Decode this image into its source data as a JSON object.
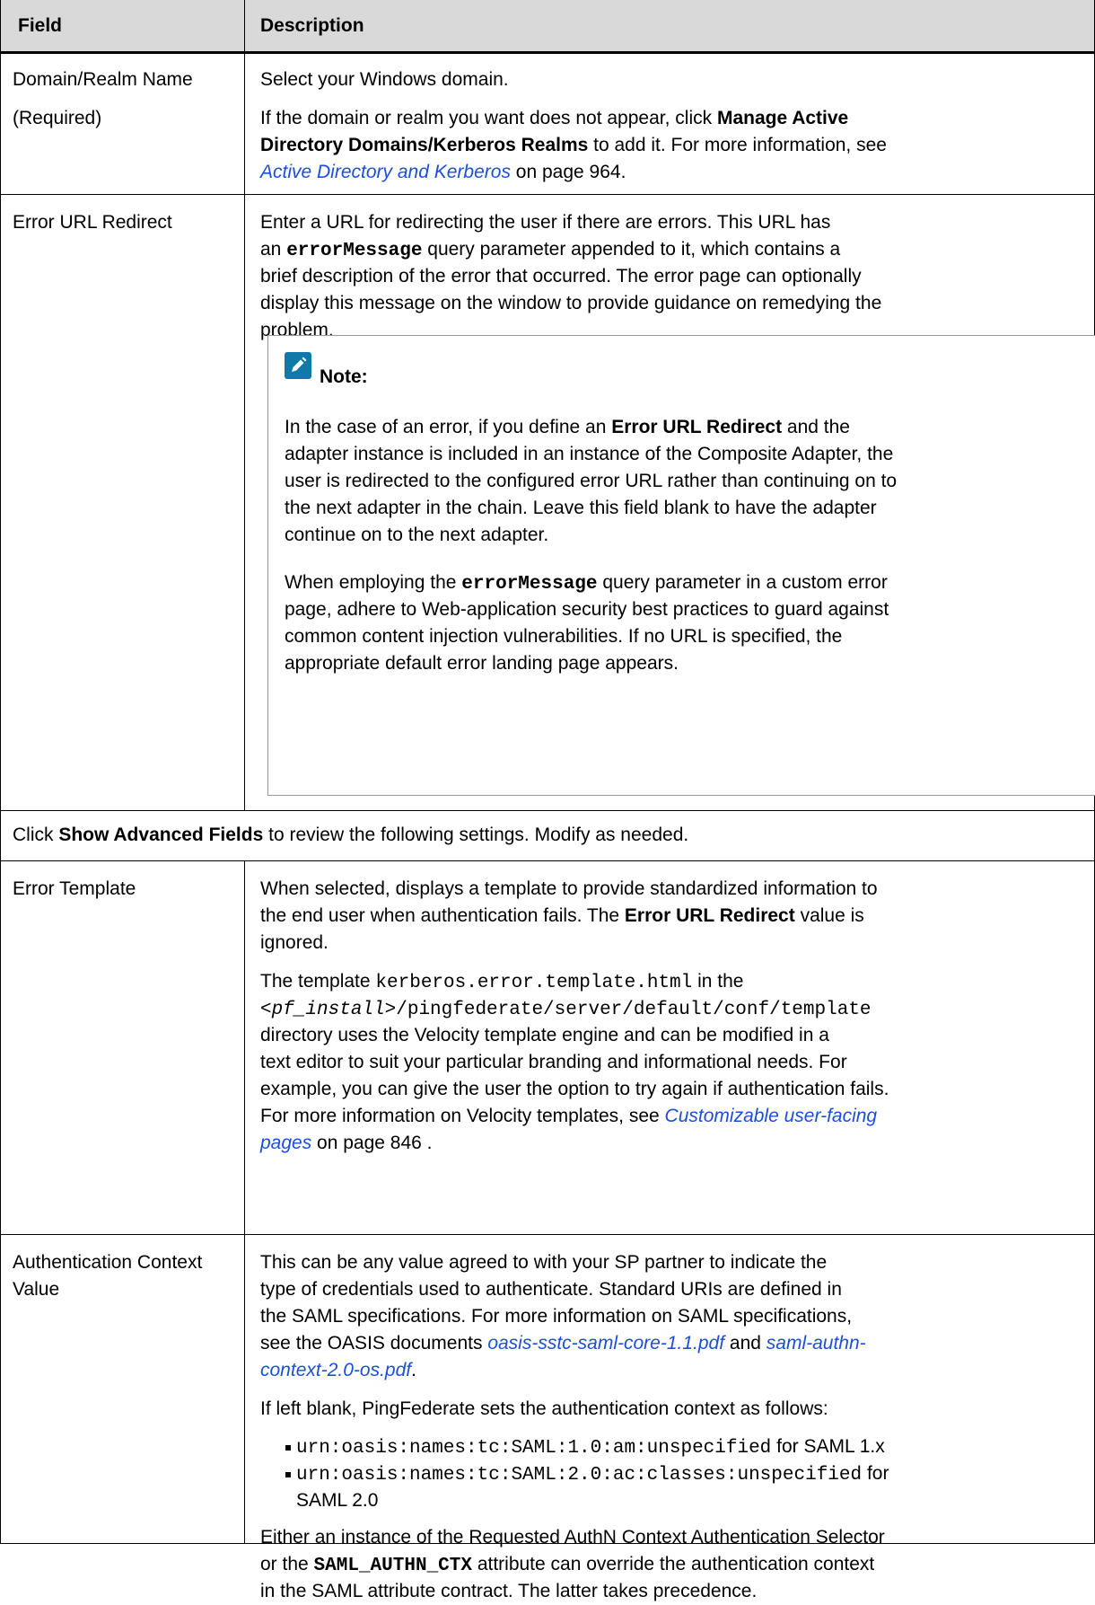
{
  "header": {
    "field": "Field",
    "description": "Description"
  },
  "row1": {
    "field1": "Domain/Realm Name",
    "field2": "(Required)",
    "desc1": "Select your Windows domain.",
    "p2_l1a": "If the domain or realm you want does not appear, click ",
    "p2_l1b": "Manage Active",
    "p2_l2a": "Directory Domains/Kerberos Realms",
    "p2_l2b": " to add it. For more information, see",
    "p2_l3_link": "Active Directory and Kerberos",
    "p2_l3b": " on page 964."
  },
  "row2": {
    "field": "Error URL Redirect",
    "l1": "Enter a URL for redirecting the user if there are errors. This URL has",
    "l2a": "an ",
    "l2_code": "errorMessage",
    "l2b": " query parameter appended to it, which contains a",
    "l3": "brief description of the error that occurred. The error page can optionally",
    "l4": "display this message on the window to provide guidance on remedying the",
    "l5": "problem.",
    "note_title": "Note:",
    "n1a": "In the case of an error, if you define an ",
    "n1b": "Error URL Redirect",
    "n1c": " and the",
    "n2": "adapter instance is included in an instance of the Composite Adapter, the",
    "n3": "user is redirected to the configured error URL rather than continuing on to",
    "n4": "the next adapter in the chain. Leave this field blank to have the adapter",
    "n5": "continue on to the next adapter.",
    "m1a": "When employing the ",
    "m1_code": "errorMessage",
    "m1b": " query parameter in a custom error",
    "m2": "page, adhere to Web-application security best practices to guard against",
    "m3": "common content injection vulnerabilities. If no URL is specified, the",
    "m4": "appropriate default error landing page appears."
  },
  "advanced": {
    "a": "Click ",
    "b": "Show Advanced Fields",
    "c": " to review the following settings. Modify as needed."
  },
  "row3": {
    "field": "Error Template",
    "l1": "When selected, displays a template to provide standardized information to",
    "l2a": "the end user when authentication fails. The ",
    "l2b": "Error URL Redirect",
    "l2c": " value is",
    "l3": "ignored.",
    "p2_l1a": "The template ",
    "p2_l1_code": "kerberos.error.template.html",
    "p2_l1b": " in the",
    "p2_l2_it": "<pf_install>",
    "p2_l2_code": "/pingfederate/server/default/conf/template",
    "p2_l3": "directory uses the Velocity template engine and can be modified in a",
    "p2_l4": "text editor to suit your particular branding and informational needs. For",
    "p2_l5": "example, you can give the user the option to try again if authentication fails.",
    "p2_l6a": "For more information on Velocity templates, see ",
    "p2_l6_link": "Customizable user-facing",
    "p2_l7_link": "pages",
    "p2_l7b": " on page 846 ."
  },
  "row4": {
    "field1": "Authentication Context",
    "field2": "Value",
    "l1": "This can be any value agreed to with your SP partner to indicate the",
    "l2": "type of credentials used to authenticate. Standard URIs are defined in",
    "l3": "the SAML specifications. For more information on SAML specifications,",
    "l4a": "see the OASIS documents ",
    "l4_link1": "oasis-sstc-saml-core-1.1.pdf",
    "l4b": " and ",
    "l4_link2": "saml-authn-",
    "l5_link": "context-2.0-os.pdf",
    "l5b": ".",
    "blank": "If left blank, PingFederate sets the authentication context as follows:",
    "b1_code": "urn:oasis:names:tc:SAML:1.0:am:unspecified",
    "b1_txt": " for SAML 1.x",
    "b2_code": "urn:oasis:names:tc:SAML:2.0:ac:classes:unspecified",
    "b2_txt": " for",
    "b2_l2": "SAML 2.0",
    "e1": "Either an instance of the Requested AuthN Context Authentication Selector",
    "e2a": "or the ",
    "e2_code": "SAML_AUTHN_CTX",
    "e2b": " attribute can override the authentication context",
    "e3": "in the SAML attribute contract. The latter takes precedence."
  },
  "colors": {
    "link": "#1c4fd8",
    "header_bg": "#d9d9d9",
    "note_icon": "#0f7aa8"
  }
}
